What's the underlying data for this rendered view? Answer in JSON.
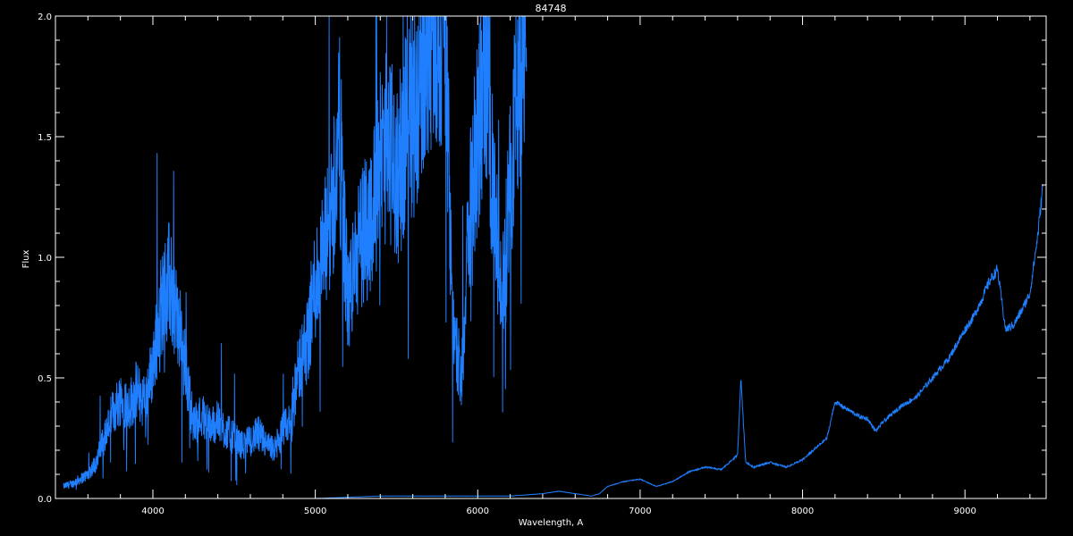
{
  "chart_data": {
    "type": "line",
    "title": "84748",
    "xlabel": "Wavelength, A",
    "ylabel": "Flux",
    "xlim": [
      3400,
      9500
    ],
    "ylim": [
      0,
      2.0
    ],
    "x_ticks": [
      4000,
      5000,
      6000,
      7000,
      8000,
      9000
    ],
    "x_tick_labels": [
      "4000",
      "5000",
      "6000",
      "7000",
      "8000",
      "9000"
    ],
    "y_ticks": [
      0.0,
      0.5,
      1.0,
      1.5,
      2.0
    ],
    "y_tick_labels": [
      "0.0",
      "0.5",
      "1.0",
      "1.5",
      "2.0"
    ],
    "grid": false,
    "colors": {
      "background": "#000000",
      "axes": "#ffffff",
      "line": "#1f7fff"
    },
    "series": [
      {
        "x": [
          3450,
          3500,
          3550,
          3600,
          3650,
          3700,
          3750,
          3800,
          3850,
          3900,
          3950,
          4000,
          4050,
          4100,
          4150,
          4200,
          4250,
          4300,
          4350,
          4400,
          4450,
          4500,
          4550,
          4600,
          4650,
          4700,
          4750,
          4800,
          4850,
          4900,
          4950,
          5000,
          5050,
          5100,
          5150,
          5200,
          5250,
          5300,
          5350,
          5400,
          5450,
          5500,
          5550,
          5600,
          5650,
          5700,
          5750,
          5800,
          5850,
          5900,
          5950,
          6000,
          6050,
          6100,
          6150,
          6200,
          6250,
          6300
        ],
        "y": [
          0.05,
          0.06,
          0.08,
          0.1,
          0.15,
          0.25,
          0.35,
          0.42,
          0.38,
          0.45,
          0.4,
          0.55,
          0.8,
          0.9,
          0.75,
          0.55,
          0.3,
          0.35,
          0.3,
          0.32,
          0.28,
          0.25,
          0.22,
          0.24,
          0.27,
          0.22,
          0.2,
          0.28,
          0.32,
          0.55,
          0.65,
          0.9,
          1.0,
          1.2,
          1.5,
          0.8,
          1.0,
          1.1,
          1.2,
          1.4,
          1.5,
          1.3,
          1.5,
          1.6,
          1.7,
          2.0,
          2.0,
          1.9,
          0.7,
          0.5,
          1.2,
          1.5,
          1.8,
          1.2,
          0.8,
          1.3,
          1.8,
          2.0
        ]
      },
      {
        "x": [
          3500,
          3800,
          4000,
          4200,
          4500,
          4800,
          5000,
          5200,
          5400,
          5600,
          5800,
          6000,
          6200,
          6400,
          6500,
          6600,
          6700,
          6750,
          6800,
          6900,
          7000,
          7100,
          7200,
          7300,
          7400,
          7500,
          7550,
          7600,
          7620,
          7650,
          7700,
          7800,
          7900,
          8000,
          8100,
          8150,
          8200,
          8250,
          8300,
          8350,
          8400,
          8450,
          8500,
          8600,
          8700,
          8800,
          8900,
          9000,
          9050,
          9100,
          9150,
          9200,
          9250,
          9300,
          9350,
          9400,
          9450,
          9480
        ],
        "y": [
          0.0,
          0.0,
          0.0,
          0.0,
          0.0,
          0.0,
          0.0,
          0.005,
          0.01,
          0.01,
          0.01,
          0.01,
          0.01,
          0.02,
          0.03,
          0.02,
          0.01,
          0.02,
          0.05,
          0.07,
          0.08,
          0.05,
          0.07,
          0.11,
          0.13,
          0.12,
          0.15,
          0.18,
          0.5,
          0.15,
          0.13,
          0.15,
          0.13,
          0.16,
          0.22,
          0.25,
          0.4,
          0.38,
          0.36,
          0.34,
          0.33,
          0.28,
          0.32,
          0.38,
          0.42,
          0.5,
          0.58,
          0.7,
          0.75,
          0.82,
          0.9,
          0.95,
          0.7,
          0.72,
          0.78,
          0.85,
          1.1,
          1.3
        ]
      }
    ]
  }
}
